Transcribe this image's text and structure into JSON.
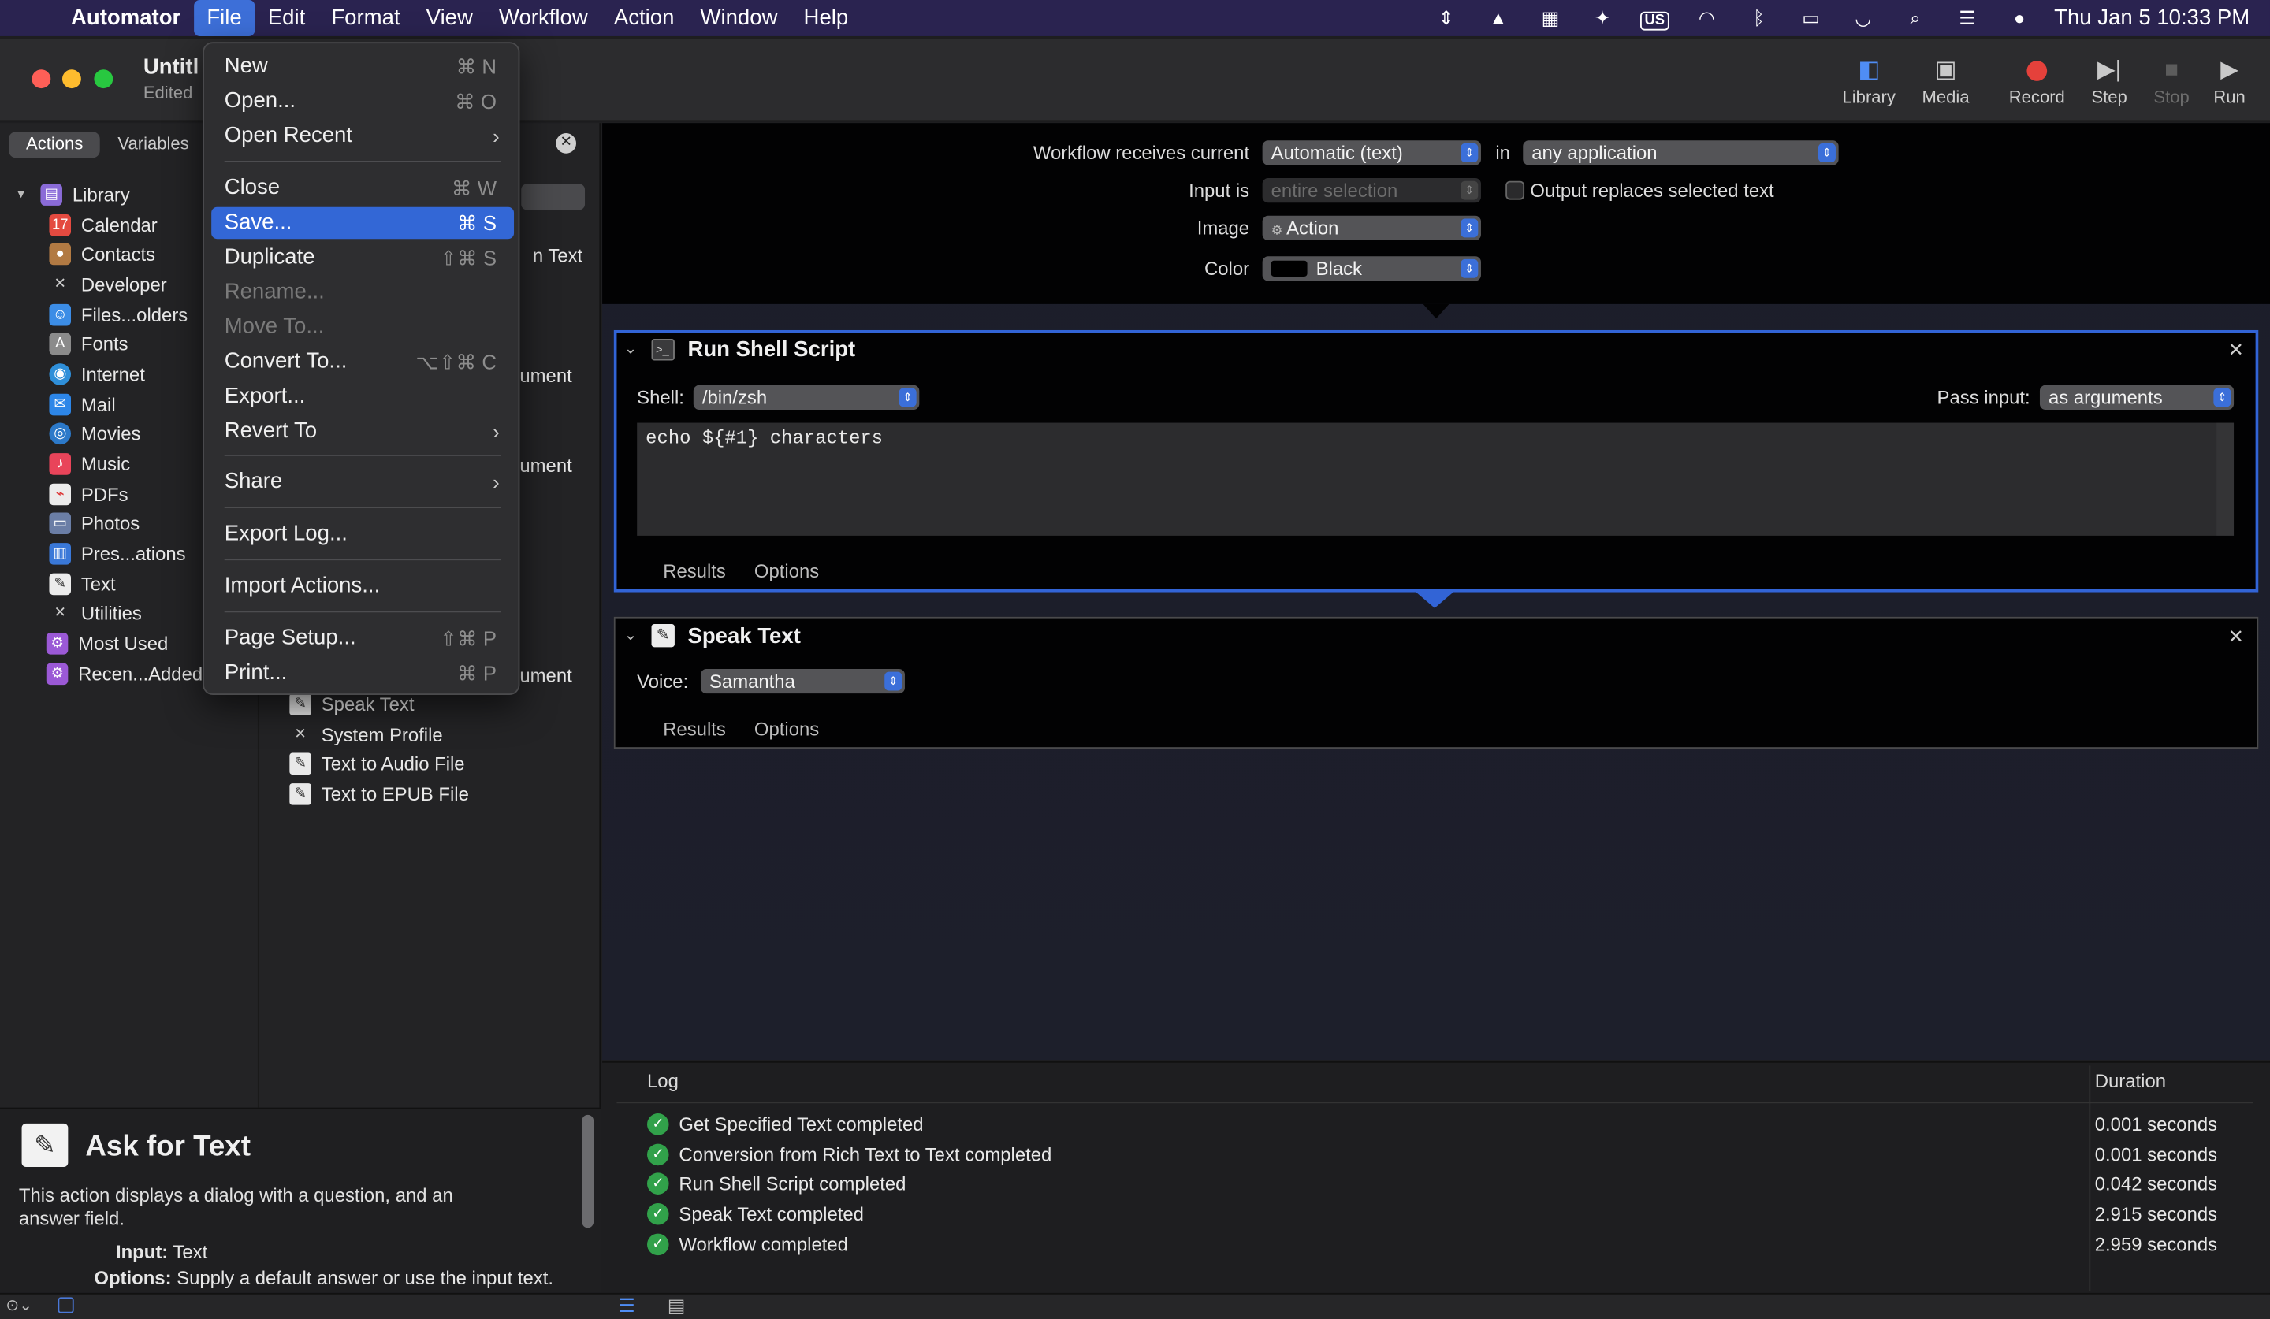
{
  "menubar": {
    "app_name": "Automator",
    "menus": [
      "File",
      "Edit",
      "Format",
      "View",
      "Workflow",
      "Action",
      "Window",
      "Help"
    ],
    "active_menu": "File",
    "clock": "Thu Jan 5  10:33 PM",
    "input_source": "US"
  },
  "window": {
    "title": "Untitl",
    "subtitle": "Edited",
    "toolbar": {
      "library": "Library",
      "media": "Media",
      "record": "Record",
      "step": "Step",
      "stop": "Stop",
      "run": "Run"
    }
  },
  "left": {
    "tabs": [
      "Actions",
      "Variables"
    ],
    "library_root": "Library",
    "library": [
      "Calendar",
      "Contacts",
      "Developer",
      "Files...olders",
      "Fonts",
      "Internet",
      "Mail",
      "Movies",
      "Music",
      "PDFs",
      "Photos",
      "Pres...ations",
      "Text",
      "Utilities"
    ],
    "smart_groups": [
      "Most Used",
      "Recen...Added"
    ],
    "actions_partial": [
      "n Text",
      "ument",
      "ument",
      "ument"
    ],
    "actions": [
      "Speak Text",
      "System Profile",
      "Text to Audio File",
      "Text to EPUB File"
    ]
  },
  "description": {
    "title": "Ask for Text",
    "body": "This action displays a dialog with a question, and an answer field.",
    "input_label": "Input:",
    "input_value": "Text",
    "options_label": "Options:",
    "options_value": "Supply a default answer or use the input text."
  },
  "workflow": {
    "receives_label": "Workflow receives current",
    "receives_value": "Automatic (text)",
    "in_label": "in",
    "in_value": "any application",
    "input_is_label": "Input is",
    "input_is_value": "entire selection",
    "output_replaces": "Output replaces selected text",
    "image_label": "Image",
    "image_value": "Action",
    "color_label": "Color",
    "color_value": "Black"
  },
  "shell_action": {
    "title": "Run Shell Script",
    "shell_label": "Shell:",
    "shell_value": "/bin/zsh",
    "pass_label": "Pass input:",
    "pass_value": "as arguments",
    "code": "echo ${#1} characters",
    "results": "Results",
    "options": "Options"
  },
  "speak_action": {
    "title": "Speak Text",
    "voice_label": "Voice:",
    "voice_value": "Samantha",
    "results": "Results",
    "options": "Options"
  },
  "log": {
    "header": "Log",
    "duration_header": "Duration",
    "rows": [
      {
        "message": "Get Specified Text completed",
        "duration": "0.001 seconds"
      },
      {
        "message": "Conversion from Rich Text to Text completed",
        "duration": "0.001 seconds"
      },
      {
        "message": "Run Shell Script completed",
        "duration": "0.042 seconds"
      },
      {
        "message": "Speak Text completed",
        "duration": "2.915 seconds"
      },
      {
        "message": "Workflow completed",
        "duration": "2.959 seconds"
      }
    ]
  },
  "file_menu": {
    "items": [
      {
        "label": "New",
        "shortcut": "⌘ N"
      },
      {
        "label": "Open...",
        "shortcut": "⌘ O"
      },
      {
        "label": "Open Recent",
        "shortcut": "›"
      },
      {
        "label": "Close",
        "shortcut": "⌘ W"
      },
      {
        "label": "Save...",
        "shortcut": "⌘ S"
      },
      {
        "label": "Duplicate",
        "shortcut": "⇧⌘ S"
      },
      {
        "label": "Rename...",
        "shortcut": ""
      },
      {
        "label": "Move To...",
        "shortcut": ""
      },
      {
        "label": "Convert To...",
        "shortcut": "⌥⇧⌘ C"
      },
      {
        "label": "Export...",
        "shortcut": ""
      },
      {
        "label": "Revert To",
        "shortcut": "›"
      },
      {
        "label": "Share",
        "shortcut": "›"
      },
      {
        "label": "Export Log...",
        "shortcut": ""
      },
      {
        "label": "Import Actions...",
        "shortcut": ""
      },
      {
        "label": "Page Setup...",
        "shortcut": "⇧⌘ P"
      },
      {
        "label": "Print...",
        "shortcut": "⌘ P"
      }
    ]
  },
  "colors": {
    "accent": "#3367d6",
    "menubar": "#2a2350",
    "success": "#31a14a",
    "record": "#e5413b"
  }
}
